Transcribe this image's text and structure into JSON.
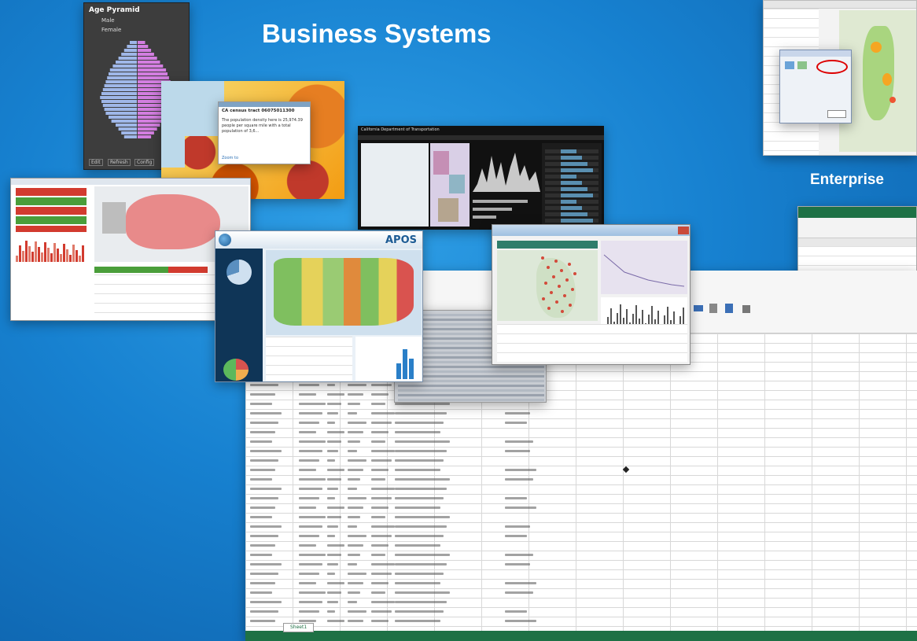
{
  "headings": {
    "main": "Business Systems",
    "enterprise": "Enterprise"
  },
  "age_pyramid": {
    "title": "Age Pyramid",
    "legend": [
      "Male",
      "Female"
    ],
    "colors": {
      "male": "#9fb7e8",
      "female": "#d37ee0",
      "bg": "#3d3d3d"
    },
    "footer_buttons": [
      "Edit",
      "Refresh",
      "Config"
    ]
  },
  "census_popup": {
    "title": "CA census tract 06075011300",
    "body": "The population density here is 25,974.39 people per square mile with a total population of 3,6...",
    "link": "Zoom to"
  },
  "caltrans": {
    "header": "California Department of Transportation",
    "colors": {
      "bg": "#111111",
      "chart": "#c9c9c9"
    }
  },
  "apos": {
    "logo": "APOS"
  },
  "spreadsheet": {
    "sheet_tab": "Sheet1"
  },
  "icons": {
    "apos_logo": "globe-icon",
    "close": "close-icon"
  }
}
